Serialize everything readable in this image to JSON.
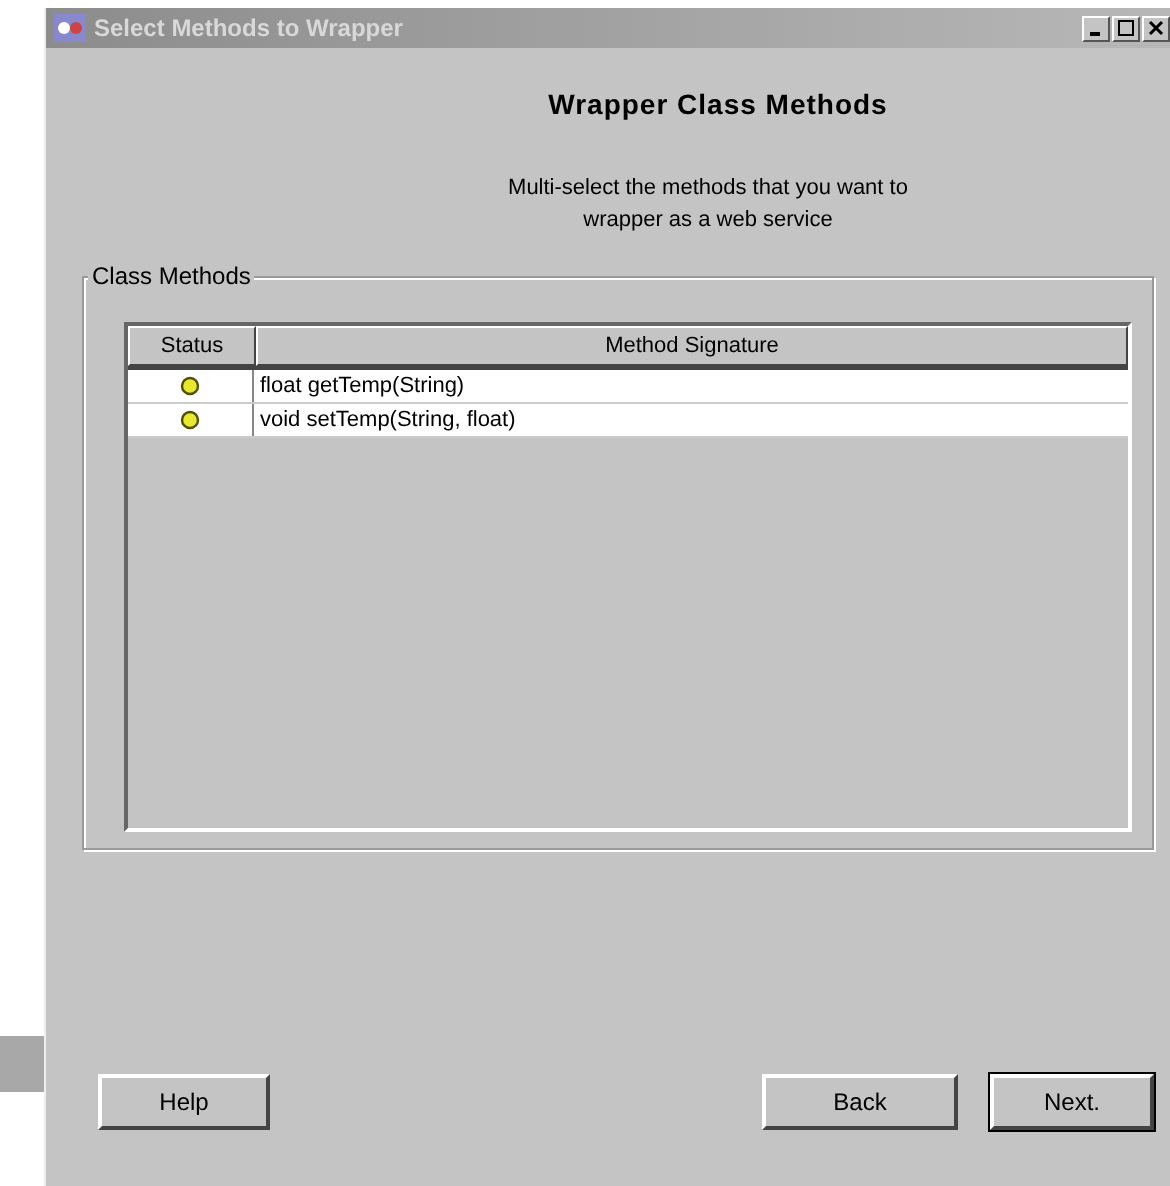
{
  "window": {
    "title": "Select Methods to Wrapper"
  },
  "heading": "Wrapper Class Methods",
  "instructions": [
    "Multi-select the methods that you want to",
    "wrapper as a web service"
  ],
  "group": {
    "title": "Class Methods"
  },
  "table": {
    "columns": [
      "Status",
      "Method Signature"
    ],
    "rows": [
      {
        "signature": "float getTemp(String)"
      },
      {
        "signature": "void setTemp(String, float)"
      }
    ]
  },
  "buttons": {
    "left": [
      "Help"
    ],
    "right": [
      "Back",
      "Next."
    ]
  }
}
